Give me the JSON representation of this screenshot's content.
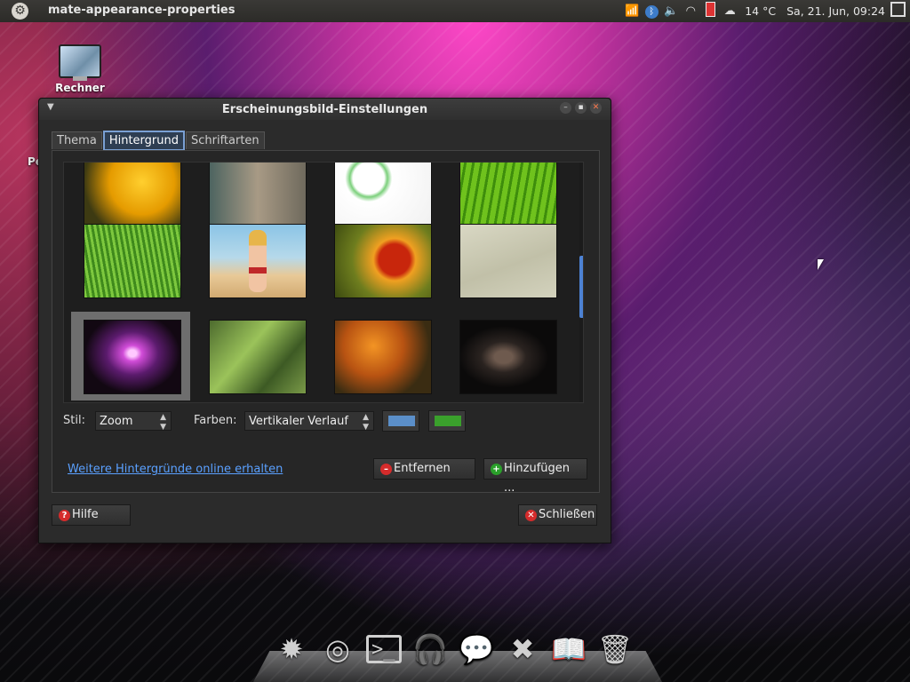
{
  "top_panel": {
    "app_title": "mate-appearance-properties",
    "temperature": "14 °C",
    "datetime": "Sa, 21. Jun, 09:24"
  },
  "desktop": {
    "icons": [
      {
        "label": "Rechner",
        "icon": "computer-icon"
      }
    ],
    "partial_label": "Pe"
  },
  "window": {
    "title": "Erscheinungsbild-Einstellungen",
    "tabs": [
      {
        "label": "Thema",
        "active": false
      },
      {
        "label": "Hintergrund",
        "active": true
      },
      {
        "label": "Schriftarten",
        "active": false
      }
    ],
    "style_label": "Stil:",
    "style_value": "Zoom",
    "colors_label": "Farben:",
    "colors_value": "Vertikaler Verlauf",
    "primary_color": "#5b8fc9",
    "secondary_color": "#3aa02c",
    "online_link": "Weitere Hintergründe online erhalten",
    "remove_button": "Entfernen",
    "add_button": "Hinzufügen ...",
    "help_button": "Hilfe",
    "close_button": "Schließen"
  },
  "wallpapers": [
    {
      "name": "orange-flower",
      "row": 0
    },
    {
      "name": "blurred-beige",
      "row": 0
    },
    {
      "name": "green-swirl-white",
      "row": 0
    },
    {
      "name": "green-leaf",
      "row": 0
    },
    {
      "name": "green-grass",
      "row": 1
    },
    {
      "name": "beach-woman",
      "row": 1
    },
    {
      "name": "red-flower",
      "row": 1
    },
    {
      "name": "sand-texture",
      "row": 1
    },
    {
      "name": "pink-cube",
      "row": 2,
      "selected": true
    },
    {
      "name": "green-stems",
      "row": 2
    },
    {
      "name": "orange-dandelion",
      "row": 2
    },
    {
      "name": "dark-figure",
      "row": 2
    }
  ],
  "dock": {
    "items": [
      "settings-gear-icon",
      "chromium-icon",
      "terminal-icon",
      "headphones-icon",
      "chat-icon",
      "close-x-icon",
      "tie-book-icon",
      "trash-icon"
    ]
  }
}
